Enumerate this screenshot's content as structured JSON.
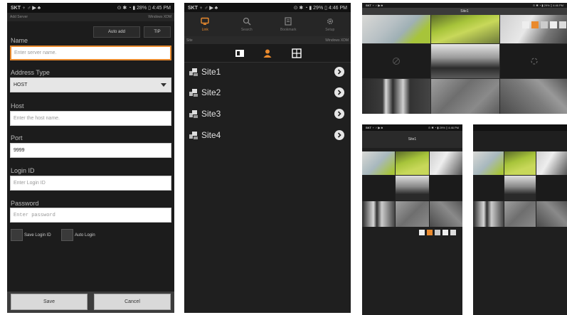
{
  "phone1": {
    "status_left": "SKT ♆ ♂ ▶ ♣",
    "status_right": "⊙ ✱ ◔ ▮ 28% ▯ 4:45 PM",
    "title_left": "Add Server",
    "title_right": "Windows XDM",
    "auto_add_label": "Auto add",
    "tip_label": "TIP",
    "name_label": "Name",
    "name_placeholder": "Enter server name.",
    "address_type_label": "Address Type",
    "address_type_value": "HOST",
    "host_label": "Host",
    "host_placeholder": "Enter the host name.",
    "port_label": "Port",
    "port_value": "9999",
    "login_id_label": "Login ID",
    "login_id_placeholder": "Enter Login ID",
    "password_label": "Password",
    "password_placeholder": "Enter password",
    "save_login_label": "Save Login ID",
    "auto_login_label": "Auto Login",
    "save_label": "Save",
    "cancel_label": "Cancel"
  },
  "phone2": {
    "status_left": "SKT ♆ ♂ ▶ ♣",
    "status_right": "⊙ ✱ ◔ ▮ 29% ▯ 4:46 PM",
    "tabs": [
      {
        "label": "Link",
        "icon": "monitor-icon"
      },
      {
        "label": "Search",
        "icon": "search-icon"
      },
      {
        "label": "Bookmark",
        "icon": "bookmark-icon"
      },
      {
        "label": "Setup",
        "icon": "gear-icon"
      }
    ],
    "sub_left": "Site",
    "sub_right": "Windows XDM",
    "sites": [
      "Site1",
      "Site2",
      "Site3",
      "Site4"
    ]
  },
  "grid1": {
    "status_left": "SKT ♆ ♂ ▶ ♣",
    "status_right": "⊙ ✱ ◔ ▮ 29% ▯ 4:46 PM",
    "header": "Site1"
  },
  "grid2": {
    "status_left": "SKT ♆ ♂ ▶ ♣",
    "status_right": "⊙ ✱ ◔ ▮ 29% ▯ 4:46 PM",
    "header": "Site1"
  },
  "colors": {
    "accent": "#e98a2e",
    "background": "#1e1e1e",
    "camera_green": "#a7c43a"
  }
}
